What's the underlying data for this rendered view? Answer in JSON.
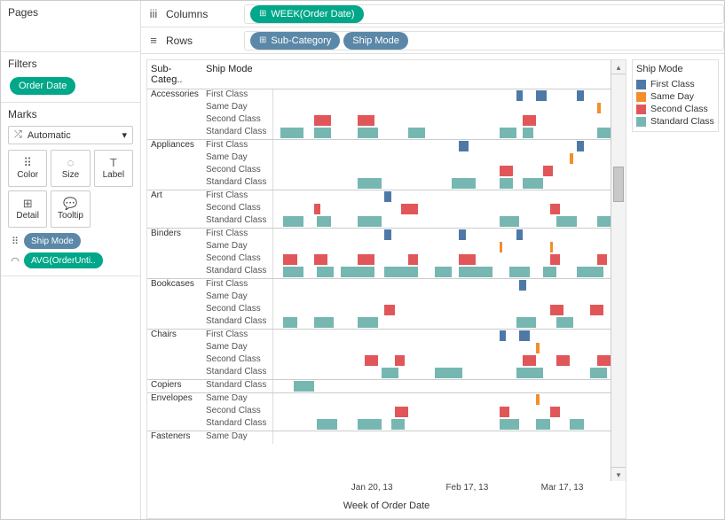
{
  "layout": {
    "pages_label": "Pages",
    "filters_label": "Filters",
    "filter_pill": "Order Date",
    "marks_label": "Marks",
    "marks_type": "Automatic",
    "mark_buttons": [
      "Color",
      "Size",
      "Label",
      "Detail",
      "Tooltip"
    ],
    "mark_pill_1": "Ship Mode",
    "mark_pill_2": "AVG(OrderUnti..",
    "columns_label": "Columns",
    "rows_label": "Rows",
    "columns_pill": "WEEK(Order Date)",
    "rows_pill_1": "Sub-Category",
    "rows_pill_2": "Ship Mode",
    "header_sub": "Sub-Categ..",
    "header_mode": "Ship Mode",
    "x_title": "Week of Order Date",
    "last_row_sub": "Fasteners",
    "last_row_mode": "Same Day"
  },
  "legend": {
    "title": "Ship Mode",
    "items": [
      {
        "label": "First Class",
        "cls": "c-first"
      },
      {
        "label": "Same Day",
        "cls": "c-same"
      },
      {
        "label": "Second Class",
        "cls": "c-second"
      },
      {
        "label": "Standard Class",
        "cls": "c-std"
      }
    ]
  },
  "x_ticks": [
    {
      "label": "Jan 20, 13",
      "pct": 28
    },
    {
      "label": "Feb 17, 13",
      "pct": 55
    },
    {
      "label": "Mar 17, 13",
      "pct": 82
    }
  ],
  "chart_data": {
    "type": "gantt",
    "title": "",
    "xlabel": "Week of Order Date",
    "x_range_pct": [
      0,
      100
    ],
    "color_field": "Ship Mode",
    "colors": {
      "First Class": "#4e79a7",
      "Same Day": "#f28e2c",
      "Second Class": "#e15759",
      "Standard Class": "#76b7b2"
    },
    "groups": [
      {
        "sub": "Accessories",
        "rows": [
          {
            "mode": "First Class",
            "cls": "c-first",
            "marks": [
              {
                "x": 72,
                "w": 2
              },
              {
                "x": 78,
                "w": 3
              },
              {
                "x": 90,
                "w": 2
              }
            ]
          },
          {
            "mode": "Same Day",
            "cls": "c-same",
            "marks": [
              {
                "x": 96,
                "w": 1
              }
            ]
          },
          {
            "mode": "Second Class",
            "cls": "c-second",
            "marks": [
              {
                "x": 12,
                "w": 5
              },
              {
                "x": 25,
                "w": 5
              },
              {
                "x": 74,
                "w": 4
              }
            ]
          },
          {
            "mode": "Standard Class",
            "cls": "c-std",
            "marks": [
              {
                "x": 2,
                "w": 7
              },
              {
                "x": 12,
                "w": 5
              },
              {
                "x": 25,
                "w": 6
              },
              {
                "x": 40,
                "w": 5
              },
              {
                "x": 67,
                "w": 5
              },
              {
                "x": 74,
                "w": 3
              },
              {
                "x": 96,
                "w": 4
              }
            ]
          }
        ]
      },
      {
        "sub": "Appliances",
        "rows": [
          {
            "mode": "First Class",
            "cls": "c-first",
            "marks": [
              {
                "x": 55,
                "w": 3
              },
              {
                "x": 90,
                "w": 2
              }
            ]
          },
          {
            "mode": "Same Day",
            "cls": "c-same",
            "marks": [
              {
                "x": 88,
                "w": 1
              }
            ]
          },
          {
            "mode": "Second Class",
            "cls": "c-second",
            "marks": [
              {
                "x": 67,
                "w": 4
              },
              {
                "x": 80,
                "w": 3
              }
            ]
          },
          {
            "mode": "Standard Class",
            "cls": "c-std",
            "marks": [
              {
                "x": 25,
                "w": 7
              },
              {
                "x": 53,
                "w": 7
              },
              {
                "x": 67,
                "w": 4
              },
              {
                "x": 74,
                "w": 6
              }
            ]
          }
        ]
      },
      {
        "sub": "Art",
        "rows": [
          {
            "mode": "First Class",
            "cls": "c-first",
            "marks": [
              {
                "x": 33,
                "w": 2
              }
            ]
          },
          {
            "mode": "Second Class",
            "cls": "c-second",
            "marks": [
              {
                "x": 12,
                "w": 2
              },
              {
                "x": 38,
                "w": 5
              },
              {
                "x": 82,
                "w": 3
              }
            ]
          },
          {
            "mode": "Standard Class",
            "cls": "c-std",
            "marks": [
              {
                "x": 3,
                "w": 6
              },
              {
                "x": 13,
                "w": 4
              },
              {
                "x": 25,
                "w": 7
              },
              {
                "x": 67,
                "w": 6
              },
              {
                "x": 84,
                "w": 6
              },
              {
                "x": 96,
                "w": 4
              }
            ]
          }
        ]
      },
      {
        "sub": "Binders",
        "rows": [
          {
            "mode": "First Class",
            "cls": "c-first",
            "marks": [
              {
                "x": 33,
                "w": 2
              },
              {
                "x": 55,
                "w": 2
              },
              {
                "x": 72,
                "w": 2
              }
            ]
          },
          {
            "mode": "Same Day",
            "cls": "c-same",
            "marks": [
              {
                "x": 67,
                "w": 1
              },
              {
                "x": 82,
                "w": 1
              }
            ]
          },
          {
            "mode": "Second Class",
            "cls": "c-second",
            "marks": [
              {
                "x": 3,
                "w": 4
              },
              {
                "x": 12,
                "w": 4
              },
              {
                "x": 25,
                "w": 5
              },
              {
                "x": 40,
                "w": 3
              },
              {
                "x": 55,
                "w": 5
              },
              {
                "x": 82,
                "w": 3
              },
              {
                "x": 96,
                "w": 3
              }
            ]
          },
          {
            "mode": "Standard Class",
            "cls": "c-std",
            "marks": [
              {
                "x": 3,
                "w": 6
              },
              {
                "x": 13,
                "w": 5
              },
              {
                "x": 20,
                "w": 10
              },
              {
                "x": 33,
                "w": 10
              },
              {
                "x": 48,
                "w": 5
              },
              {
                "x": 55,
                "w": 10
              },
              {
                "x": 70,
                "w": 6
              },
              {
                "x": 80,
                "w": 4
              },
              {
                "x": 90,
                "w": 8
              }
            ]
          }
        ]
      },
      {
        "sub": "Bookcases",
        "rows": [
          {
            "mode": "First Class",
            "cls": "c-first",
            "marks": [
              {
                "x": 73,
                "w": 2
              }
            ]
          },
          {
            "mode": "Same Day",
            "cls": "c-same",
            "marks": []
          },
          {
            "mode": "Second Class",
            "cls": "c-second",
            "marks": [
              {
                "x": 33,
                "w": 3
              },
              {
                "x": 82,
                "w": 4
              },
              {
                "x": 94,
                "w": 4
              }
            ]
          },
          {
            "mode": "Standard Class",
            "cls": "c-std",
            "marks": [
              {
                "x": 3,
                "w": 4
              },
              {
                "x": 12,
                "w": 6
              },
              {
                "x": 25,
                "w": 6
              },
              {
                "x": 72,
                "w": 6
              },
              {
                "x": 84,
                "w": 5
              }
            ]
          }
        ]
      },
      {
        "sub": "Chairs",
        "rows": [
          {
            "mode": "First Class",
            "cls": "c-first",
            "marks": [
              {
                "x": 67,
                "w": 2
              },
              {
                "x": 73,
                "w": 3
              }
            ]
          },
          {
            "mode": "Same Day",
            "cls": "c-same",
            "marks": [
              {
                "x": 78,
                "w": 1
              }
            ]
          },
          {
            "mode": "Second Class",
            "cls": "c-second",
            "marks": [
              {
                "x": 27,
                "w": 4
              },
              {
                "x": 36,
                "w": 3
              },
              {
                "x": 74,
                "w": 4
              },
              {
                "x": 84,
                "w": 4
              },
              {
                "x": 96,
                "w": 4
              }
            ]
          },
          {
            "mode": "Standard Class",
            "cls": "c-std",
            "marks": [
              {
                "x": 32,
                "w": 5
              },
              {
                "x": 48,
                "w": 8
              },
              {
                "x": 72,
                "w": 8
              },
              {
                "x": 94,
                "w": 5
              }
            ]
          }
        ]
      },
      {
        "sub": "Copiers",
        "rows": [
          {
            "mode": "Standard Class",
            "cls": "c-std",
            "marks": [
              {
                "x": 6,
                "w": 6
              }
            ]
          }
        ]
      },
      {
        "sub": "Envelopes",
        "rows": [
          {
            "mode": "Same Day",
            "cls": "c-same",
            "marks": [
              {
                "x": 78,
                "w": 1
              }
            ]
          },
          {
            "mode": "Second Class",
            "cls": "c-second",
            "marks": [
              {
                "x": 36,
                "w": 4
              },
              {
                "x": 67,
                "w": 3
              },
              {
                "x": 82,
                "w": 3
              }
            ]
          },
          {
            "mode": "Standard Class",
            "cls": "c-std",
            "marks": [
              {
                "x": 13,
                "w": 6
              },
              {
                "x": 25,
                "w": 7
              },
              {
                "x": 35,
                "w": 4
              },
              {
                "x": 67,
                "w": 6
              },
              {
                "x": 78,
                "w": 4
              },
              {
                "x": 88,
                "w": 4
              }
            ]
          }
        ]
      }
    ]
  }
}
